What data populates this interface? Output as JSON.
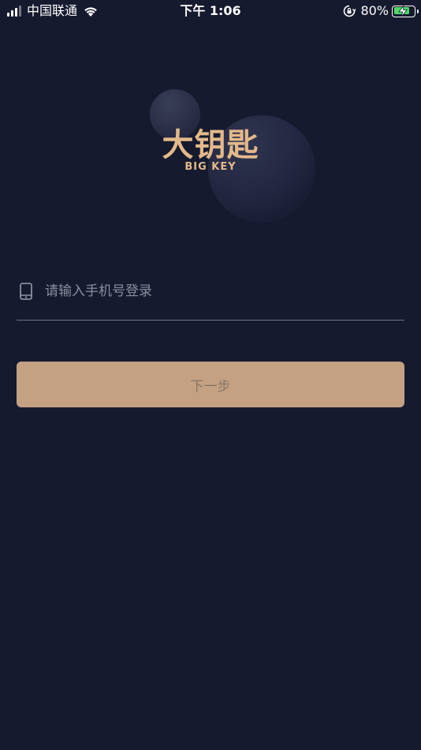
{
  "status_bar": {
    "carrier": "中国联通",
    "time": "下午 1:06",
    "battery_percent": "80%",
    "battery_level": 0.8,
    "icons": [
      "signal-icon",
      "wifi-icon",
      "rotation-lock-icon",
      "battery-charging-icon"
    ]
  },
  "logo": {
    "chinese": "大钥匙",
    "english": "BIG KEY",
    "color": "#e3b98a"
  },
  "login": {
    "phone_placeholder": "请输入手机号登录",
    "phone_value": "",
    "phone_icon": "mobile-phone-icon",
    "next_label": "下一步"
  },
  "colors": {
    "background": "#161a2f",
    "button": "#c4a182",
    "accent": "#e3b98a"
  }
}
